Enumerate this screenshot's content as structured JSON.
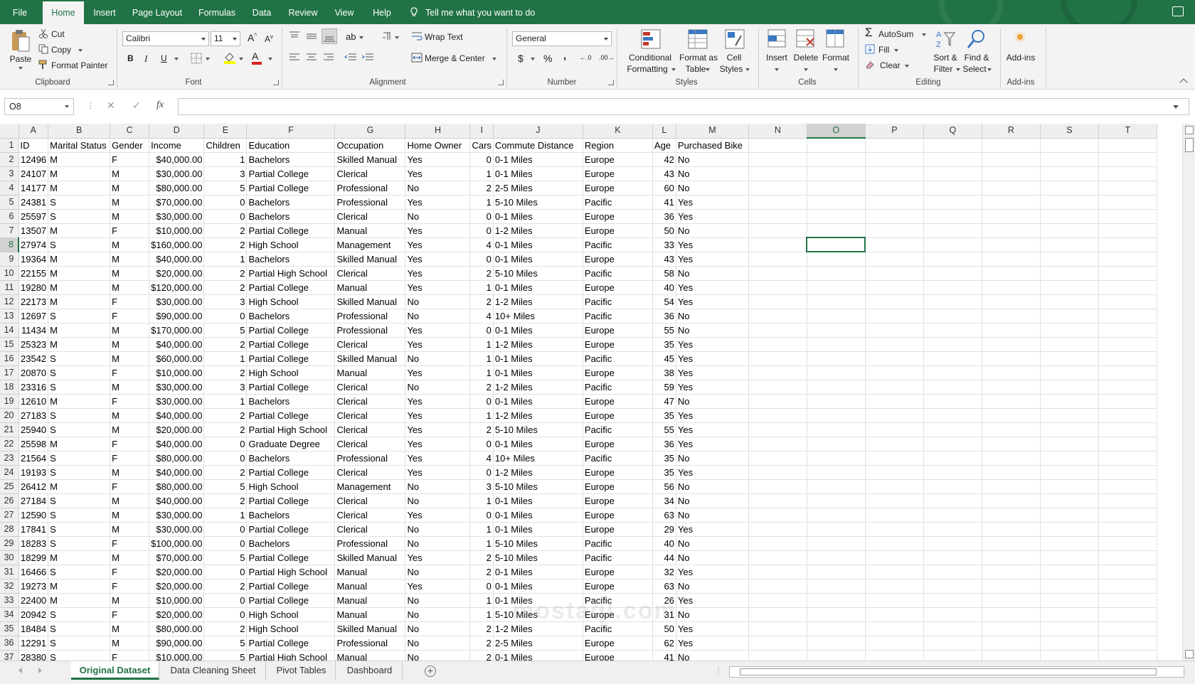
{
  "menu": {
    "items": [
      "File",
      "Home",
      "Insert",
      "Page Layout",
      "Formulas",
      "Data",
      "Review",
      "View",
      "Help"
    ],
    "active": "Home",
    "tell_me": "Tell me what you want to do"
  },
  "ribbon": {
    "clipboard": {
      "paste": "Paste",
      "cut": "Cut",
      "copy": "Copy",
      "format_painter": "Format Painter",
      "label": "Clipboard"
    },
    "font": {
      "name": "Calibri",
      "size": "11",
      "bold": "B",
      "italic": "I",
      "underline": "U",
      "label": "Font"
    },
    "alignment": {
      "wrap_text": "Wrap Text",
      "merge_center": "Merge & Center",
      "label": "Alignment"
    },
    "number": {
      "format": "General",
      "currency": "$",
      "percent": "%",
      "comma": ",",
      "label": "Number"
    },
    "styles": {
      "conditional_1": "Conditional",
      "conditional_2": "Formatting",
      "format_table_1": "Format as",
      "format_table_2": "Table",
      "cell_styles_1": "Cell",
      "cell_styles_2": "Styles",
      "label": "Styles"
    },
    "cells": {
      "insert": "Insert",
      "delete": "Delete",
      "format": "Format",
      "label": "Cells"
    },
    "editing": {
      "autosum": "AutoSum",
      "fill": "Fill",
      "clear": "Clear",
      "sort_1": "Sort &",
      "sort_2": "Filter",
      "find_1": "Find &",
      "find_2": "Select",
      "label": "Editing"
    },
    "addins": {
      "addins": "Add-ins",
      "label": "Add-ins"
    }
  },
  "formula_bar": {
    "name_box": "O8",
    "cancel": "✕",
    "enter": "✓",
    "fx": "fx",
    "value": ""
  },
  "sheet": {
    "columns": [
      "A",
      "B",
      "C",
      "D",
      "E",
      "F",
      "G",
      "H",
      "I",
      "J",
      "K",
      "L",
      "M",
      "N",
      "O",
      "P",
      "Q",
      "R",
      "S",
      "T"
    ],
    "selected_column": "O",
    "selected_row": 8,
    "headers": [
      "ID",
      "Marital Status",
      "Gender",
      "Income",
      "Children",
      "Education",
      "Occupation",
      "Home Owner",
      "Cars",
      "Commute Distance",
      "Region",
      "Age",
      "Purchased Bike"
    ],
    "rows": [
      [
        "12496",
        "M",
        "F",
        "$40,000.00",
        "1",
        "Bachelors",
        "Skilled Manual",
        "Yes",
        "0",
        "0-1 Miles",
        "Europe",
        "42",
        "No"
      ],
      [
        "24107",
        "M",
        "M",
        "$30,000.00",
        "3",
        "Partial College",
        "Clerical",
        "Yes",
        "1",
        "0-1 Miles",
        "Europe",
        "43",
        "No"
      ],
      [
        "14177",
        "M",
        "M",
        "$80,000.00",
        "5",
        "Partial College",
        "Professional",
        "No",
        "2",
        "2-5 Miles",
        "Europe",
        "60",
        "No"
      ],
      [
        "24381",
        "S",
        "M",
        "$70,000.00",
        "0",
        "Bachelors",
        "Professional",
        "Yes",
        "1",
        "5-10 Miles",
        "Pacific",
        "41",
        "Yes"
      ],
      [
        "25597",
        "S",
        "M",
        "$30,000.00",
        "0",
        "Bachelors",
        "Clerical",
        "No",
        "0",
        "0-1 Miles",
        "Europe",
        "36",
        "Yes"
      ],
      [
        "13507",
        "M",
        "F",
        "$10,000.00",
        "2",
        "Partial College",
        "Manual",
        "Yes",
        "0",
        "1-2 Miles",
        "Europe",
        "50",
        "No"
      ],
      [
        "27974",
        "S",
        "M",
        "$160,000.00",
        "2",
        "High School",
        "Management",
        "Yes",
        "4",
        "0-1 Miles",
        "Pacific",
        "33",
        "Yes"
      ],
      [
        "19364",
        "M",
        "M",
        "$40,000.00",
        "1",
        "Bachelors",
        "Skilled Manual",
        "Yes",
        "0",
        "0-1 Miles",
        "Europe",
        "43",
        "Yes"
      ],
      [
        "22155",
        "M",
        "M",
        "$20,000.00",
        "2",
        "Partial High School",
        "Clerical",
        "Yes",
        "2",
        "5-10 Miles",
        "Pacific",
        "58",
        "No"
      ],
      [
        "19280",
        "M",
        "M",
        "$120,000.00",
        "2",
        "Partial College",
        "Manual",
        "Yes",
        "1",
        "0-1 Miles",
        "Europe",
        "40",
        "Yes"
      ],
      [
        "22173",
        "M",
        "F",
        "$30,000.00",
        "3",
        "High School",
        "Skilled Manual",
        "No",
        "2",
        "1-2 Miles",
        "Pacific",
        "54",
        "Yes"
      ],
      [
        "12697",
        "S",
        "F",
        "$90,000.00",
        "0",
        "Bachelors",
        "Professional",
        "No",
        "4",
        "10+ Miles",
        "Pacific",
        "36",
        "No"
      ],
      [
        "11434",
        "M",
        "M",
        "$170,000.00",
        "5",
        "Partial College",
        "Professional",
        "Yes",
        "0",
        "0-1 Miles",
        "Europe",
        "55",
        "No"
      ],
      [
        "25323",
        "M",
        "M",
        "$40,000.00",
        "2",
        "Partial College",
        "Clerical",
        "Yes",
        "1",
        "1-2 Miles",
        "Europe",
        "35",
        "Yes"
      ],
      [
        "23542",
        "S",
        "M",
        "$60,000.00",
        "1",
        "Partial College",
        "Skilled Manual",
        "No",
        "1",
        "0-1 Miles",
        "Pacific",
        "45",
        "Yes"
      ],
      [
        "20870",
        "S",
        "F",
        "$10,000.00",
        "2",
        "High School",
        "Manual",
        "Yes",
        "1",
        "0-1 Miles",
        "Europe",
        "38",
        "Yes"
      ],
      [
        "23316",
        "S",
        "M",
        "$30,000.00",
        "3",
        "Partial College",
        "Clerical",
        "No",
        "2",
        "1-2 Miles",
        "Pacific",
        "59",
        "Yes"
      ],
      [
        "12610",
        "M",
        "F",
        "$30,000.00",
        "1",
        "Bachelors",
        "Clerical",
        "Yes",
        "0",
        "0-1 Miles",
        "Europe",
        "47",
        "No"
      ],
      [
        "27183",
        "S",
        "M",
        "$40,000.00",
        "2",
        "Partial College",
        "Clerical",
        "Yes",
        "1",
        "1-2 Miles",
        "Europe",
        "35",
        "Yes"
      ],
      [
        "25940",
        "S",
        "M",
        "$20,000.00",
        "2",
        "Partial High School",
        "Clerical",
        "Yes",
        "2",
        "5-10 Miles",
        "Pacific",
        "55",
        "Yes"
      ],
      [
        "25598",
        "M",
        "F",
        "$40,000.00",
        "0",
        "Graduate Degree",
        "Clerical",
        "Yes",
        "0",
        "0-1 Miles",
        "Europe",
        "36",
        "Yes"
      ],
      [
        "21564",
        "S",
        "F",
        "$80,000.00",
        "0",
        "Bachelors",
        "Professional",
        "Yes",
        "4",
        "10+ Miles",
        "Pacific",
        "35",
        "No"
      ],
      [
        "19193",
        "S",
        "M",
        "$40,000.00",
        "2",
        "Partial College",
        "Clerical",
        "Yes",
        "0",
        "1-2 Miles",
        "Europe",
        "35",
        "Yes"
      ],
      [
        "26412",
        "M",
        "F",
        "$80,000.00",
        "5",
        "High School",
        "Management",
        "No",
        "3",
        "5-10 Miles",
        "Europe",
        "56",
        "No"
      ],
      [
        "27184",
        "S",
        "M",
        "$40,000.00",
        "2",
        "Partial College",
        "Clerical",
        "No",
        "1",
        "0-1 Miles",
        "Europe",
        "34",
        "No"
      ],
      [
        "12590",
        "S",
        "M",
        "$30,000.00",
        "1",
        "Bachelors",
        "Clerical",
        "Yes",
        "0",
        "0-1 Miles",
        "Europe",
        "63",
        "No"
      ],
      [
        "17841",
        "S",
        "M",
        "$30,000.00",
        "0",
        "Partial College",
        "Clerical",
        "No",
        "1",
        "0-1 Miles",
        "Europe",
        "29",
        "Yes"
      ],
      [
        "18283",
        "S",
        "F",
        "$100,000.00",
        "0",
        "Bachelors",
        "Professional",
        "No",
        "1",
        "5-10 Miles",
        "Pacific",
        "40",
        "No"
      ],
      [
        "18299",
        "M",
        "M",
        "$70,000.00",
        "5",
        "Partial College",
        "Skilled Manual",
        "Yes",
        "2",
        "5-10 Miles",
        "Pacific",
        "44",
        "No"
      ],
      [
        "16466",
        "S",
        "F",
        "$20,000.00",
        "0",
        "Partial High School",
        "Manual",
        "No",
        "2",
        "0-1 Miles",
        "Europe",
        "32",
        "Yes"
      ],
      [
        "19273",
        "M",
        "F",
        "$20,000.00",
        "2",
        "Partial College",
        "Manual",
        "Yes",
        "0",
        "0-1 Miles",
        "Europe",
        "63",
        "No"
      ],
      [
        "22400",
        "M",
        "M",
        "$10,000.00",
        "0",
        "Partial College",
        "Manual",
        "No",
        "1",
        "0-1 Miles",
        "Pacific",
        "26",
        "Yes"
      ],
      [
        "20942",
        "S",
        "F",
        "$20,000.00",
        "0",
        "High School",
        "Manual",
        "No",
        "1",
        "5-10 Miles",
        "Europe",
        "31",
        "No"
      ],
      [
        "18484",
        "S",
        "M",
        "$80,000.00",
        "2",
        "High School",
        "Skilled Manual",
        "No",
        "2",
        "1-2 Miles",
        "Pacific",
        "50",
        "Yes"
      ],
      [
        "12291",
        "S",
        "M",
        "$90,000.00",
        "5",
        "Partial College",
        "Professional",
        "No",
        "2",
        "2-5 Miles",
        "Europe",
        "62",
        "Yes"
      ],
      [
        "28380",
        "S",
        "F",
        "$10,000.00",
        "5",
        "Partial High School",
        "Manual",
        "No",
        "2",
        "0-1 Miles",
        "Europe",
        "41",
        "No"
      ]
    ]
  },
  "tabs": {
    "items": [
      "Original Dataset",
      "Data Cleaning Sheet",
      "Pivot Tables",
      "Dashboard"
    ],
    "active": "Original Dataset"
  },
  "watermark": "mostaql.com",
  "colors": {
    "accent": "#217346",
    "ribbon_bg": "#f3f3f3",
    "grid_line": "#e1e1e1"
  }
}
